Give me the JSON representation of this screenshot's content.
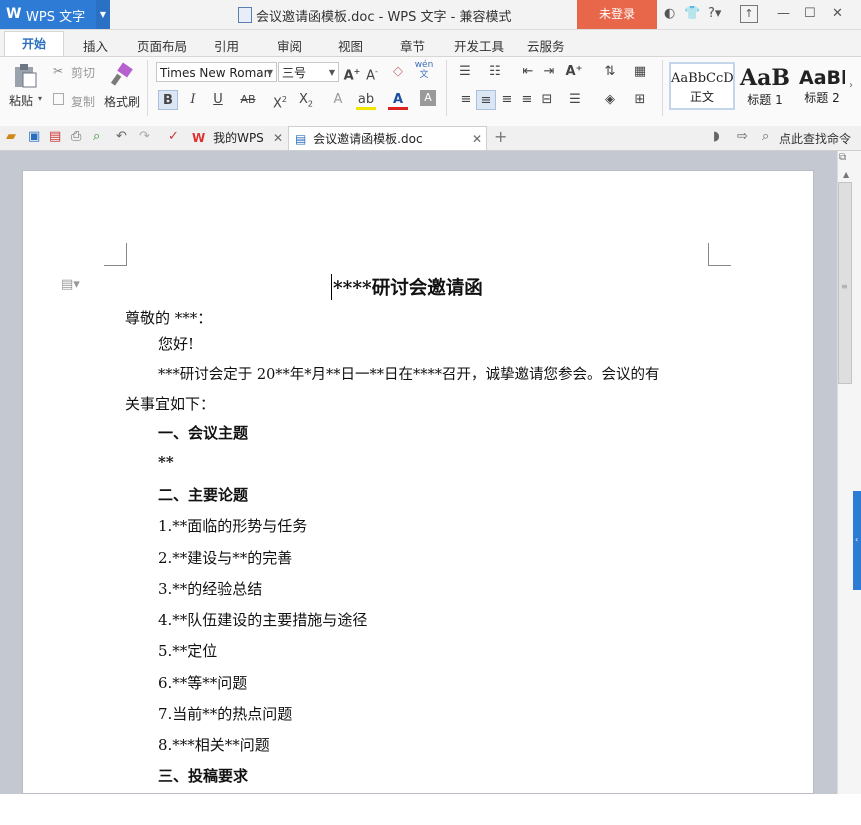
{
  "titlebar": {
    "app_logo": "W",
    "app_name": "WPS 文字",
    "doc_title": "会议邀请函模板.doc - WPS 文字 - 兼容模式",
    "login_label": "未登录"
  },
  "menu": {
    "tabs": [
      "开始",
      "插入",
      "页面布局",
      "引用",
      "审阅",
      "视图",
      "章节",
      "开发工具",
      "云服务"
    ]
  },
  "ribbon": {
    "paste_label": "粘贴",
    "cut_label": "剪切",
    "copy_label": "复制",
    "format_painter_label": "格式刷",
    "font_name": "Times New Roman",
    "font_size": "三号",
    "styles": [
      {
        "preview": "AaBbCcD",
        "name": "正文"
      },
      {
        "preview": "AaB",
        "name": "标题 1"
      },
      {
        "preview": "AaBl",
        "name": "标题 2"
      }
    ],
    "active_align": "center"
  },
  "doc_tabs": {
    "tab1_label": "我的WPS",
    "tab2_label": "会议邀请函模板.doc",
    "search_label": "点此查找命令"
  },
  "document": {
    "title": "****研讨会邀请函",
    "greeting": "尊敬的    ***：",
    "hello": "您好!",
    "para1_line1": "***研讨会定于 20**年*月**日一**日在****召开，诚挚邀请您参会。会议的有",
    "para1_line2": "关事宜如下：",
    "section1": "一、会议主题",
    "section1_body": "**",
    "section2": "二、主要论题",
    "topics": [
      "1.**面临的形势与任务",
      "2.**建设与**的完善",
      "3.**的经验总结",
      "4.**队伍建设的主要措施与途径",
      "5.**定位",
      "6.**等**问题",
      "7.当前**的热点问题",
      "8.***相关**问题"
    ],
    "section3": "三、投稿要求"
  },
  "colors": {
    "accent": "#2e7bd6",
    "login": "#e8674a",
    "workspace": "#c4c8d1"
  }
}
